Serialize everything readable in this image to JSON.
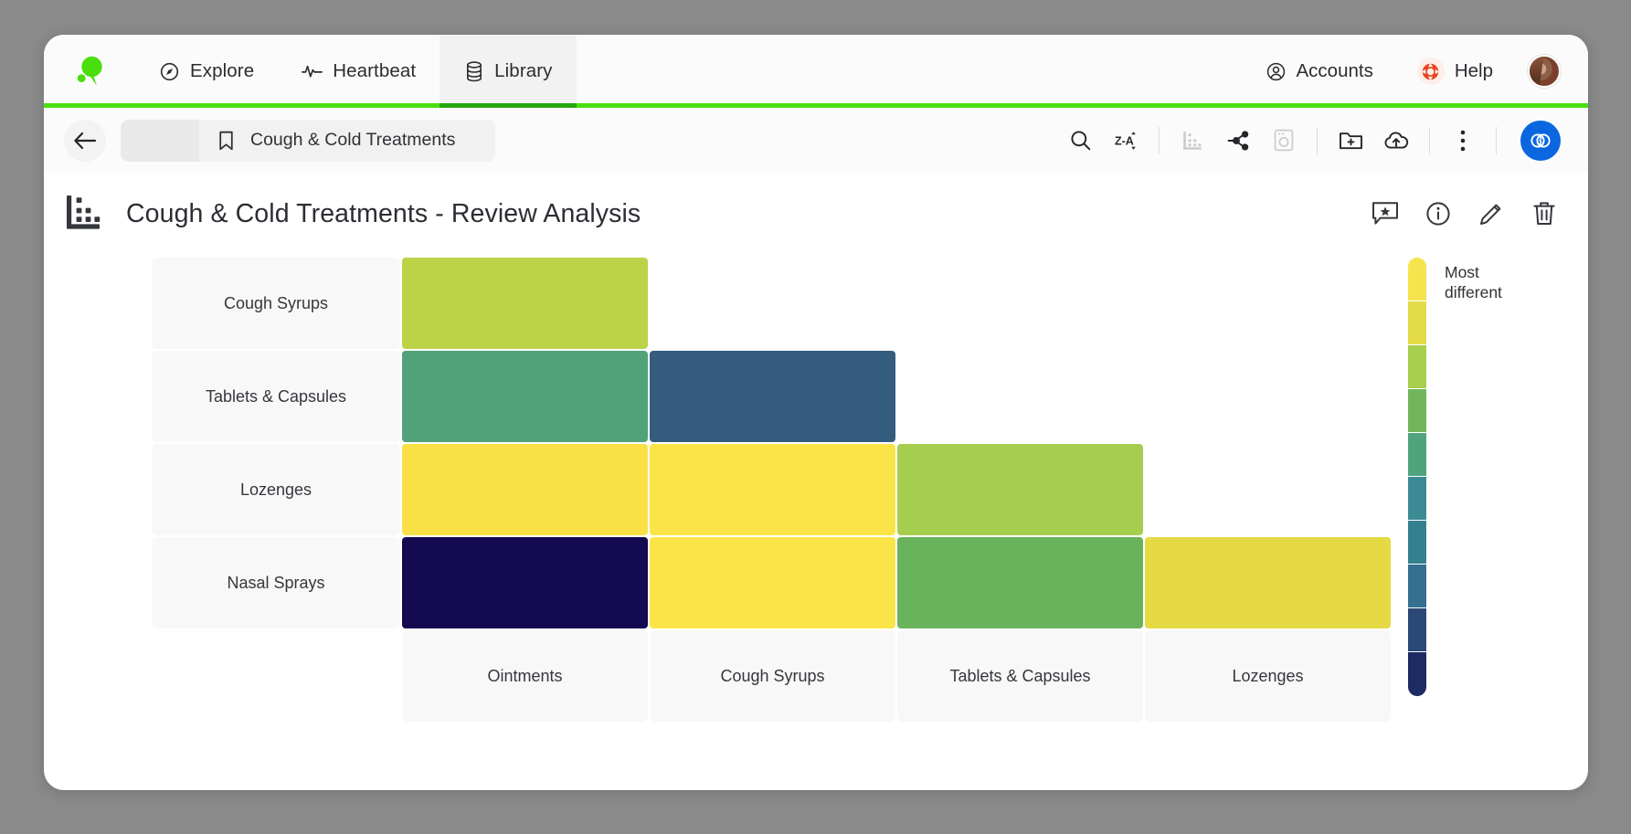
{
  "brand": {
    "logo_name": "q-logo",
    "accent_green": "#4ade10"
  },
  "topnav": {
    "items": [
      {
        "label": "Explore",
        "icon": "compass-icon",
        "active": false
      },
      {
        "label": "Heartbeat",
        "icon": "pulse-icon",
        "active": false
      },
      {
        "label": "Library",
        "icon": "database-icon",
        "active": true
      }
    ],
    "right": [
      {
        "label": "Accounts",
        "icon": "account-circle-icon"
      },
      {
        "label": "Help",
        "icon": "lifebuoy-icon"
      }
    ],
    "avatar_name": "user-avatar"
  },
  "subbar": {
    "back_icon": "arrow-left-icon",
    "breadcrumb": {
      "icon": "bookmark-icon",
      "label": "Cough & Cold Treatments"
    },
    "tools": [
      {
        "name": "search-icon",
        "label": "Search",
        "disabled": false
      },
      {
        "name": "sort-za-icon",
        "label": "Sort Z-A",
        "disabled": false
      },
      {
        "name": "chart-icon",
        "label": "Chart",
        "disabled": true
      },
      {
        "name": "share-nodes-icon",
        "label": "Share",
        "disabled": false
      },
      {
        "name": "device-icon",
        "label": "Device",
        "disabled": true
      },
      {
        "name": "new-folder-icon",
        "label": "New folder",
        "disabled": false
      },
      {
        "name": "cloud-upload-icon",
        "label": "Upload",
        "disabled": false
      },
      {
        "name": "more-vertical-icon",
        "label": "More options",
        "disabled": false
      }
    ],
    "venn_button": {
      "name": "compare-venn-button",
      "color": "#0b67e0"
    }
  },
  "title": {
    "icon": "chart-matrix-icon",
    "text": "Cough & Cold Treatments - Review Analysis",
    "actions": [
      {
        "name": "comment-star-icon",
        "label": "Annotate"
      },
      {
        "name": "info-circle-icon",
        "label": "Info"
      },
      {
        "name": "edit-pencil-icon",
        "label": "Edit"
      },
      {
        "name": "delete-trash-icon",
        "label": "Delete"
      }
    ]
  },
  "chart_data": {
    "type": "heatmap",
    "title": "Cough & Cold Treatments - Review Analysis",
    "xlabel": "",
    "ylabel": "",
    "rows": [
      "Cough Syrups",
      "Tablets & Capsules",
      "Lozenges",
      "Nasal Sprays"
    ],
    "columns": [
      "Ointments",
      "Cough Syrups",
      "Tablets & Capsules",
      "Lozenges"
    ],
    "layout": "lower-triangular",
    "cells": [
      [
        {
          "color": "#bcd348",
          "filled": true
        },
        {
          "color": "",
          "filled": false
        },
        {
          "color": "",
          "filled": false
        },
        {
          "color": "",
          "filled": false
        }
      ],
      [
        {
          "color": "#51a179",
          "filled": true
        },
        {
          "color": "#335c7f",
          "filled": true
        },
        {
          "color": "",
          "filled": false
        },
        {
          "color": "",
          "filled": false
        }
      ],
      [
        {
          "color": "#fae047",
          "filled": true
        },
        {
          "color": "#fae448",
          "filled": true
        },
        {
          "color": "#a6ce4e",
          "filled": true
        },
        {
          "color": "",
          "filled": false
        }
      ],
      [
        {
          "color": "#140a52",
          "filled": true
        },
        {
          "color": "#fae448",
          "filled": true
        },
        {
          "color": "#6ab35d",
          "filled": true
        },
        {
          "color": "#e5d944",
          "filled": true
        }
      ]
    ],
    "legend": {
      "position": "right",
      "top_label": "Most different",
      "colors": [
        "#f6e44e",
        "#e4dc46",
        "#a8ce4d",
        "#72b55c",
        "#4fa47d",
        "#3c8a94",
        "#35808f",
        "#366f92",
        "#2c4877",
        "#1e2a63"
      ]
    }
  }
}
